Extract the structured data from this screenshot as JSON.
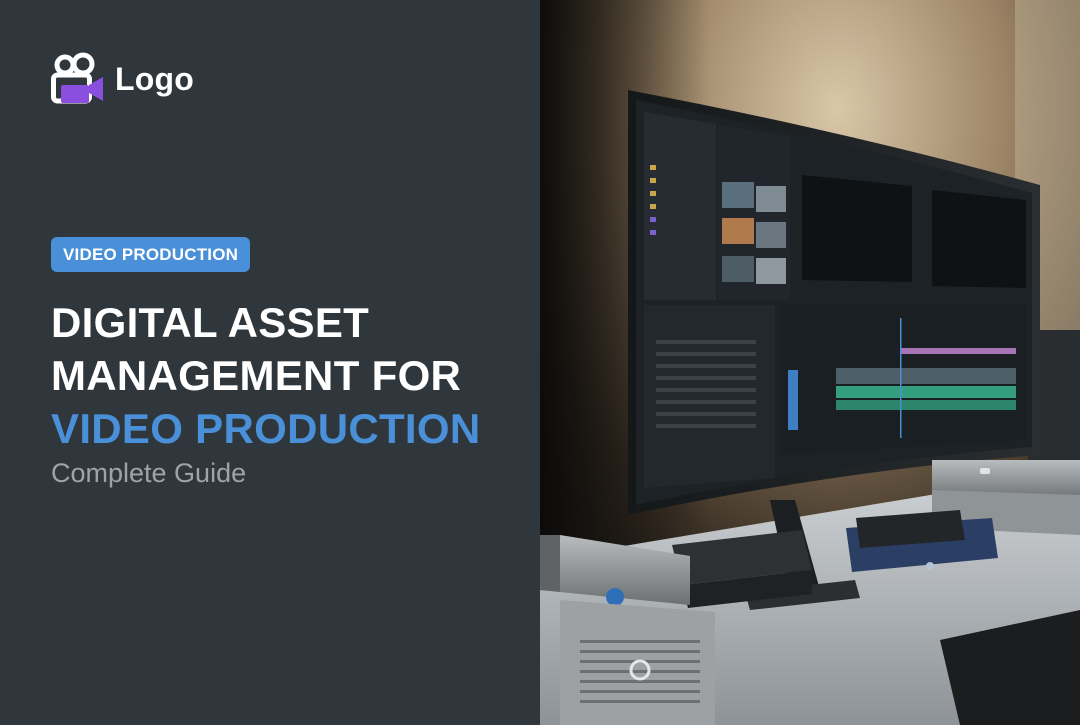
{
  "brand": {
    "logo_text": "Logo",
    "icon": "video-camera-icon",
    "colors": {
      "icon_white": "#ffffff",
      "icon_purple": "#8b4fe0"
    }
  },
  "hero": {
    "tag": "VIDEO PRODUCTION",
    "title_lines": [
      "DIGITAL ASSET",
      "MANAGEMENT FOR"
    ],
    "title_accent": "VIDEO PRODUCTION",
    "subtitle": "Complete Guide"
  },
  "colors": {
    "panel_bg": "#30373c",
    "accent": "#4a90d9",
    "title": "#ffffff",
    "subtitle": "#9ea3a6"
  },
  "photo": {
    "subject": "curved-monitor-with-video-editor-and-storage-drives"
  }
}
